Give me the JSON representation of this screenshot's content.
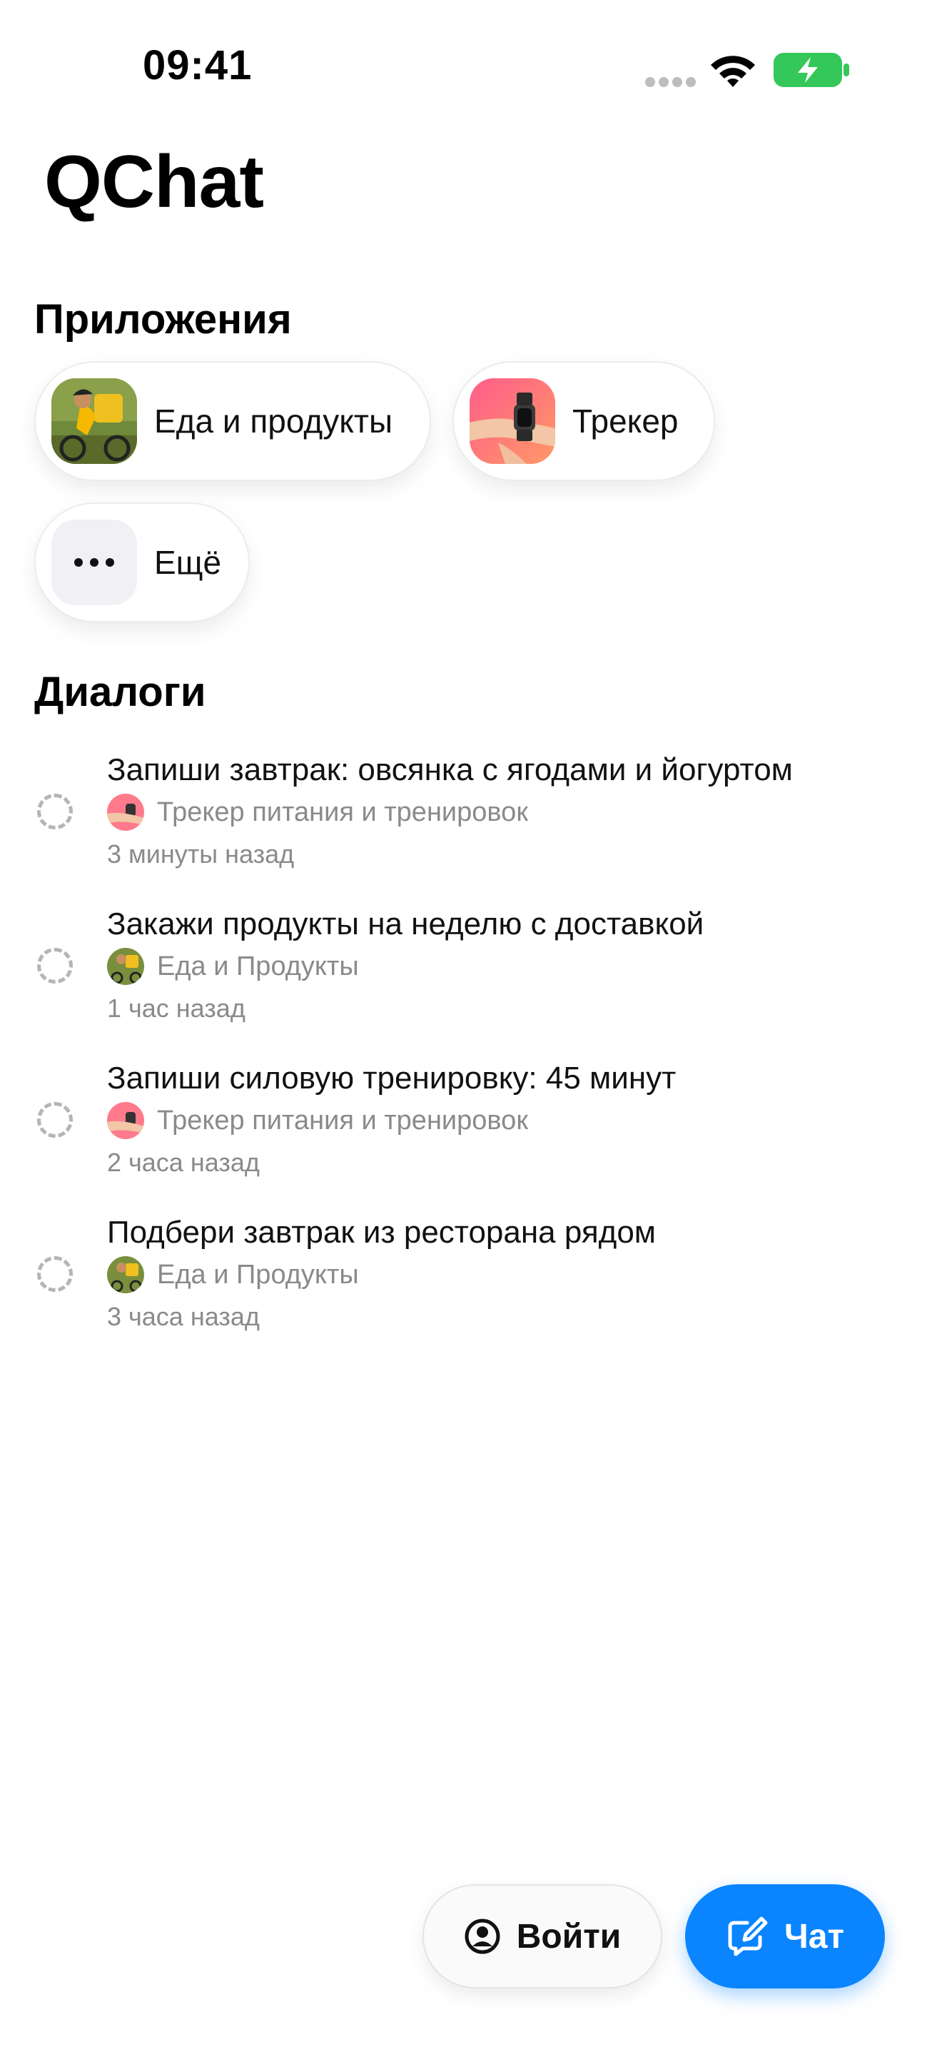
{
  "status_bar": {
    "time": "09:41"
  },
  "app": {
    "title": "QChat"
  },
  "apps_section": {
    "title": "Приложения",
    "items": [
      {
        "label": "Еда и продукты",
        "icon": "cyclist-courier-image"
      },
      {
        "label": "Трекер",
        "icon": "smartwatch-hand-image"
      },
      {
        "label": "Ещё",
        "icon": "more-icon"
      }
    ]
  },
  "dialogs_section": {
    "title": "Диалоги",
    "items": [
      {
        "title": "Запиши завтрак: овсянка с ягодами и йогуртом",
        "app": "Трекер питания и тренировок",
        "time": "3 минуты назад"
      },
      {
        "title": "Закажи продукты на неделю с доставкой",
        "app": "Еда и Продукты",
        "time": "1 час назад"
      },
      {
        "title": "Запиши силовую тренировку: 45 минут",
        "app": "Трекер питания и тренировок",
        "time": "2 часа назад"
      },
      {
        "title": "Подбери завтрак из ресторана рядом",
        "app": "Еда и Продукты",
        "time": "3 часа назад"
      }
    ]
  },
  "bottom": {
    "login_label": "Войти",
    "chat_label": "Чат"
  },
  "colors": {
    "accent": "#0a84ff",
    "battery": "#34c759",
    "secondary_text": "#8a8a8a"
  }
}
